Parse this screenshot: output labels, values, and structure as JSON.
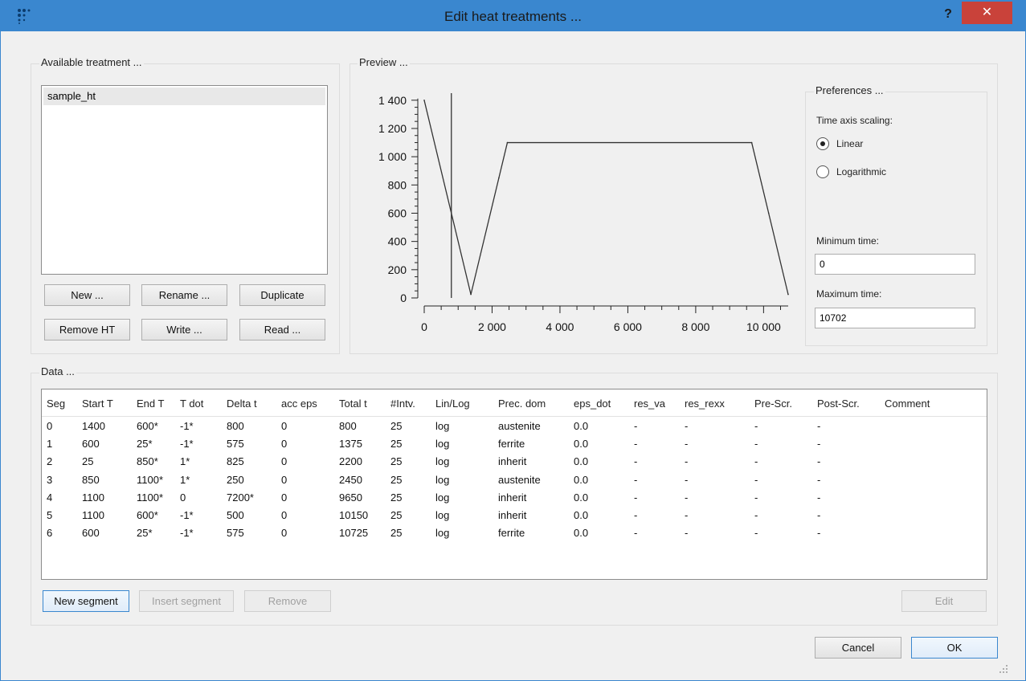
{
  "window": {
    "title": "Edit heat treatments ...",
    "help": "?",
    "close": "✕"
  },
  "available": {
    "label": "Available treatment ...",
    "items": [
      "sample_ht"
    ],
    "buttons": {
      "new": "New ...",
      "rename": "Rename ...",
      "duplicate": "Duplicate",
      "remove_ht": "Remove HT",
      "write": "Write ...",
      "read": "Read ..."
    }
  },
  "preview": {
    "label": "Preview ...",
    "chart_data": {
      "type": "line",
      "x": [
        0,
        800,
        1375,
        2200,
        2450,
        9650,
        10150,
        10725
      ],
      "values": [
        1400,
        600,
        25,
        850,
        1100,
        1100,
        600,
        25
      ],
      "xlim": [
        0,
        10725
      ],
      "ylim": [
        0,
        1450
      ],
      "y_ticks": [
        "1 400",
        "1 200",
        "1 000",
        "800",
        "600",
        "400",
        "200",
        "0"
      ],
      "y_tick_values": [
        1400,
        1200,
        1000,
        800,
        600,
        400,
        200,
        0
      ],
      "x_ticks": [
        "0",
        "2 000",
        "4 000",
        "6 000",
        "8 000",
        "10 000"
      ],
      "x_tick_values": [
        0,
        2000,
        4000,
        6000,
        8000,
        10000
      ],
      "marker_x": 800,
      "grid": false
    }
  },
  "preferences": {
    "label": "Preferences ...",
    "time_axis_label": "Time axis scaling:",
    "linear_label": "Linear",
    "log_label": "Logarithmic",
    "selected": "Linear",
    "min_time_label": "Minimum time:",
    "min_time": "0",
    "max_time_label": "Maximum time:",
    "max_time": "10702"
  },
  "data": {
    "label": "Data ...",
    "columns": [
      "Seg",
      "Start T",
      "End T",
      "T dot",
      "Delta t",
      "acc eps",
      "Total t",
      "#Intv.",
      "Lin/Log",
      "Prec. dom",
      "eps_dot",
      "res_va",
      "res_rexx",
      "Pre-Scr.",
      "Post-Scr.",
      "Comment"
    ],
    "rows": [
      [
        "0",
        "1400",
        "600*",
        "-1*",
        "800",
        "0",
        "800",
        "25",
        "log",
        "austenite",
        "0.0",
        "-",
        "-",
        "-",
        "-",
        ""
      ],
      [
        "1",
        "600",
        "25*",
        "-1*",
        "575",
        "0",
        "1375",
        "25",
        "log",
        "ferrite",
        "0.0",
        "-",
        "-",
        "-",
        "-",
        ""
      ],
      [
        "2",
        "25",
        "850*",
        "1*",
        "825",
        "0",
        "2200",
        "25",
        "log",
        "inherit",
        "0.0",
        "-",
        "-",
        "-",
        "-",
        ""
      ],
      [
        "3",
        "850",
        "1100*",
        "1*",
        "250",
        "0",
        "2450",
        "25",
        "log",
        "austenite",
        "0.0",
        "-",
        "-",
        "-",
        "-",
        ""
      ],
      [
        "4",
        "1100",
        "1100*",
        "0",
        "7200*",
        "0",
        "9650",
        "25",
        "log",
        "inherit",
        "0.0",
        "-",
        "-",
        "-",
        "-",
        ""
      ],
      [
        "5",
        "1100",
        "600*",
        "-1*",
        "500",
        "0",
        "10150",
        "25",
        "log",
        "inherit",
        "0.0",
        "-",
        "-",
        "-",
        "-",
        ""
      ],
      [
        "6",
        "600",
        "25*",
        "-1*",
        "575",
        "0",
        "10725",
        "25",
        "log",
        "ferrite",
        "0.0",
        "-",
        "-",
        "-",
        "-",
        ""
      ]
    ],
    "buttons": {
      "new_segment": "New segment",
      "insert_segment": "Insert segment",
      "remove": "Remove",
      "edit": "Edit"
    }
  },
  "footer": {
    "cancel": "Cancel",
    "ok": "OK"
  },
  "colors": {
    "titlebar": "#3a87cf",
    "close": "#c9423a"
  },
  "icons": {
    "app": "dots-app-icon",
    "close": "close-icon",
    "help": "help-icon"
  }
}
